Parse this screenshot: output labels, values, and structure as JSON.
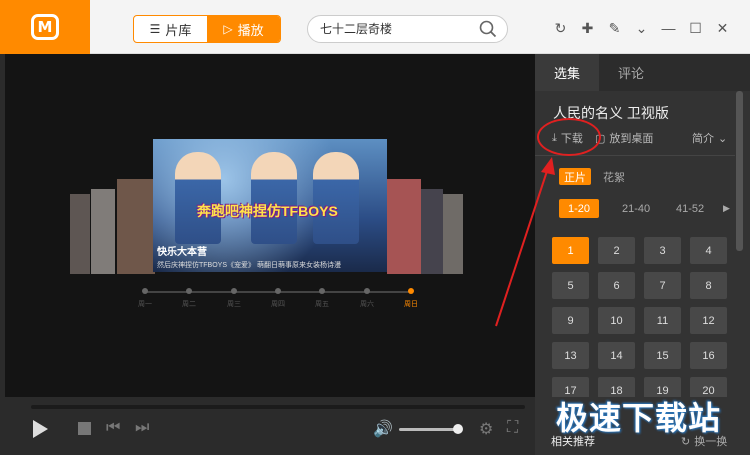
{
  "header": {
    "logo_text": "M",
    "segment": {
      "library_label": "片库",
      "play_label": "播放"
    },
    "search": {
      "placeholder": "七十二层奇楼"
    }
  },
  "player": {
    "hero": {
      "title": "奔跑吧神捏仿TFBOYS",
      "show": "快乐大本营",
      "caption": "然后庆神捏仿TFBOYS《宠爱》 萌翻日萌事原来女装杨诗漫"
    },
    "timeline": [
      {
        "label": "周一",
        "active": false
      },
      {
        "label": "周二",
        "active": false
      },
      {
        "label": "周三",
        "active": false
      },
      {
        "label": "周四",
        "active": false
      },
      {
        "label": "周五",
        "active": false
      },
      {
        "label": "周六",
        "active": false
      },
      {
        "label": "周日",
        "active": true
      }
    ]
  },
  "panel": {
    "tabs": [
      {
        "label": "选集"
      },
      {
        "label": "评论"
      }
    ],
    "show_title": "人民的名义 卫视版",
    "actions": {
      "download": "下载",
      "desktop": "放到桌面",
      "intro": "简介"
    },
    "filters": {
      "main": "正片",
      "extras": "花絮"
    },
    "ranges": [
      "1-20",
      "21-40",
      "41-52"
    ],
    "episodes": [
      "1",
      "2",
      "3",
      "4",
      "5",
      "6",
      "7",
      "8",
      "9",
      "10",
      "11",
      "12",
      "13",
      "14",
      "15",
      "16",
      "17",
      "18",
      "19",
      "20"
    ],
    "related": "相关推荐",
    "refresh": "换一换"
  },
  "watermark": "极速下载站",
  "colors": {
    "accent": "#ff8a00",
    "annotation": "#e02020"
  }
}
